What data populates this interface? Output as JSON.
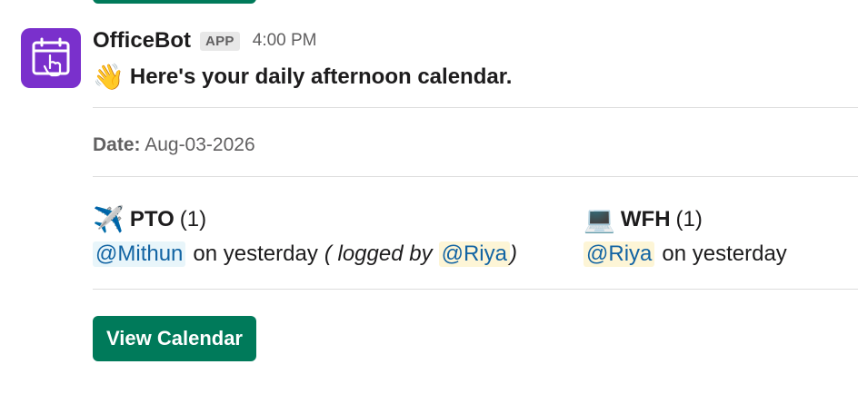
{
  "colors": {
    "accent": "#007a5a",
    "avatar_bg": "#7a30cc",
    "mention_text": "#1264a3"
  },
  "message": {
    "bot_name": "OfficeBot",
    "badge": "APP",
    "time": "4:00 PM",
    "avatar_icon": "calendar-touch-icon",
    "headline_emoji": "👋",
    "headline": "Here's your daily afternoon calendar.",
    "date_label": "Date:",
    "date_value": "Aug-03-2026"
  },
  "pto": {
    "emoji": "✈️",
    "title": "PTO",
    "count": "(1)",
    "mention": "@Mithun",
    "text": "on yesterday",
    "logged_open": "( logged by",
    "logged_mention": "@Riya",
    "logged_close": ")"
  },
  "wfh": {
    "emoji": "💻",
    "title": "WFH",
    "count": "(1)",
    "mention": "@Riya",
    "text": "on yesterday"
  },
  "button": {
    "label": "View Calendar"
  }
}
